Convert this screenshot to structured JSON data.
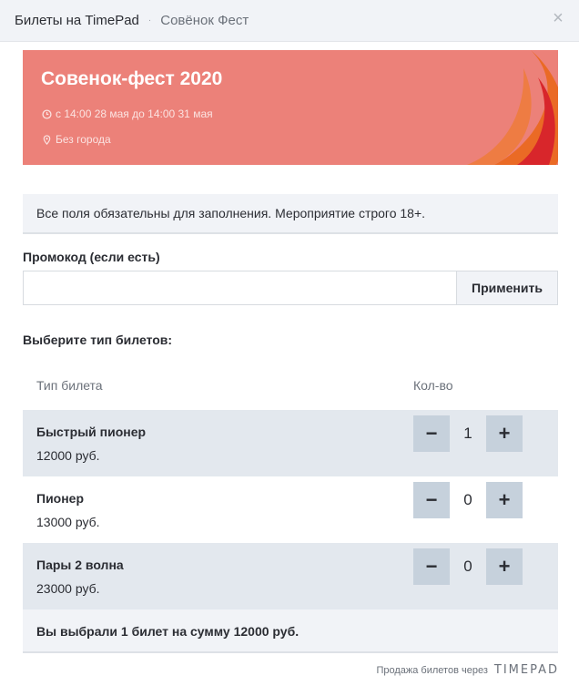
{
  "header": {
    "title": "Билеты на TimePad",
    "separator": "·",
    "event_name": "Совёнок Фест",
    "close_glyph": "×"
  },
  "banner": {
    "title": "Совенок-фест 2020",
    "date": "с 14:00 28 мая до 14:00 31 мая",
    "place": "Без города",
    "background_color": "#ec8179",
    "date_icon": "clock-icon",
    "place_icon": "location-pin-icon"
  },
  "notice": {
    "text": "Все поля обязательны для заполнения. Мероприятие строго 18+."
  },
  "promo": {
    "label": "Промокод (если есть)",
    "value": "",
    "placeholder": "",
    "apply_label": "Применить"
  },
  "tickets": {
    "heading": "Выберите тип билетов:",
    "columns": [
      "Тип билета",
      "Кол-во"
    ],
    "rows": [
      {
        "name": "Быстрый пионер",
        "price": "12000 руб.",
        "qty": "1",
        "minus": "−",
        "plus": "+"
      },
      {
        "name": "Пионер",
        "price": "13000 руб.",
        "qty": "0",
        "minus": "−",
        "plus": "+"
      },
      {
        "name": "Пары 2 волна",
        "price": "23000 руб.",
        "qty": "0",
        "minus": "−",
        "plus": "+"
      }
    ]
  },
  "summary": {
    "text": "Вы выбрали 1 билет на сумму 12000 руб."
  },
  "footer": {
    "powered_text": "Продажа билетов через",
    "logo_text": "TIMEPAD"
  }
}
